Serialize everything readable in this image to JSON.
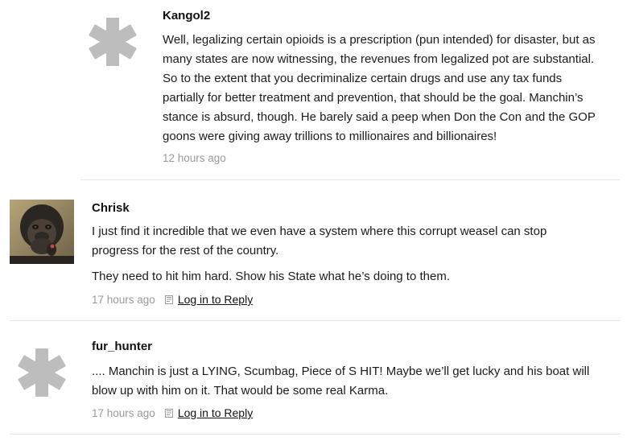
{
  "comments": [
    {
      "author": "Kangol2",
      "avatar": "asterisk-placeholder",
      "text_lines": [
        "Well, legalizing certain opioids is a prescription (pun intended) for disaster, but as",
        "many states are now witnessing, the revenues from legalized pot are substantial.",
        "So to the extent that you decriminalize certain drugs and use any tax funds",
        "partially for better treatment and prevention, that should be the goal. Manchin’s",
        "stance is absurd, though. He barely said a peep when Don the Con and the GOP",
        "goons were giving away trillions to millionaires and billionaires!"
      ],
      "time": "12 hours ago"
    },
    {
      "author": "Chrisk",
      "avatar": "gorilla-photo",
      "paragraph1_lines": [
        "I just find it incredible that we even have a system where this corrupt weasel can stop",
        "progress for the rest of the country."
      ],
      "paragraph2": "They need to hit him hard. Show his State what he’s doing to them.",
      "time": "17 hours ago",
      "reply_label": "Log in to Reply"
    },
    {
      "author": "fur_hunter",
      "avatar": "asterisk-placeholder",
      "text_lines": [
        ".... Manchin is just a LYING, Scumbag, Piece of S HIT! Maybe we’ll get lucky and his boat will",
        "blow up with him on it. That would be some real Karma."
      ],
      "time": "17 hours ago",
      "reply_label": "Log in to Reply"
    }
  ],
  "colors": {
    "placeholder_avatar": "#bdbdbd",
    "timestamp": "#999999",
    "divider": "#e6e6e6",
    "text": "#1a1a1a"
  }
}
